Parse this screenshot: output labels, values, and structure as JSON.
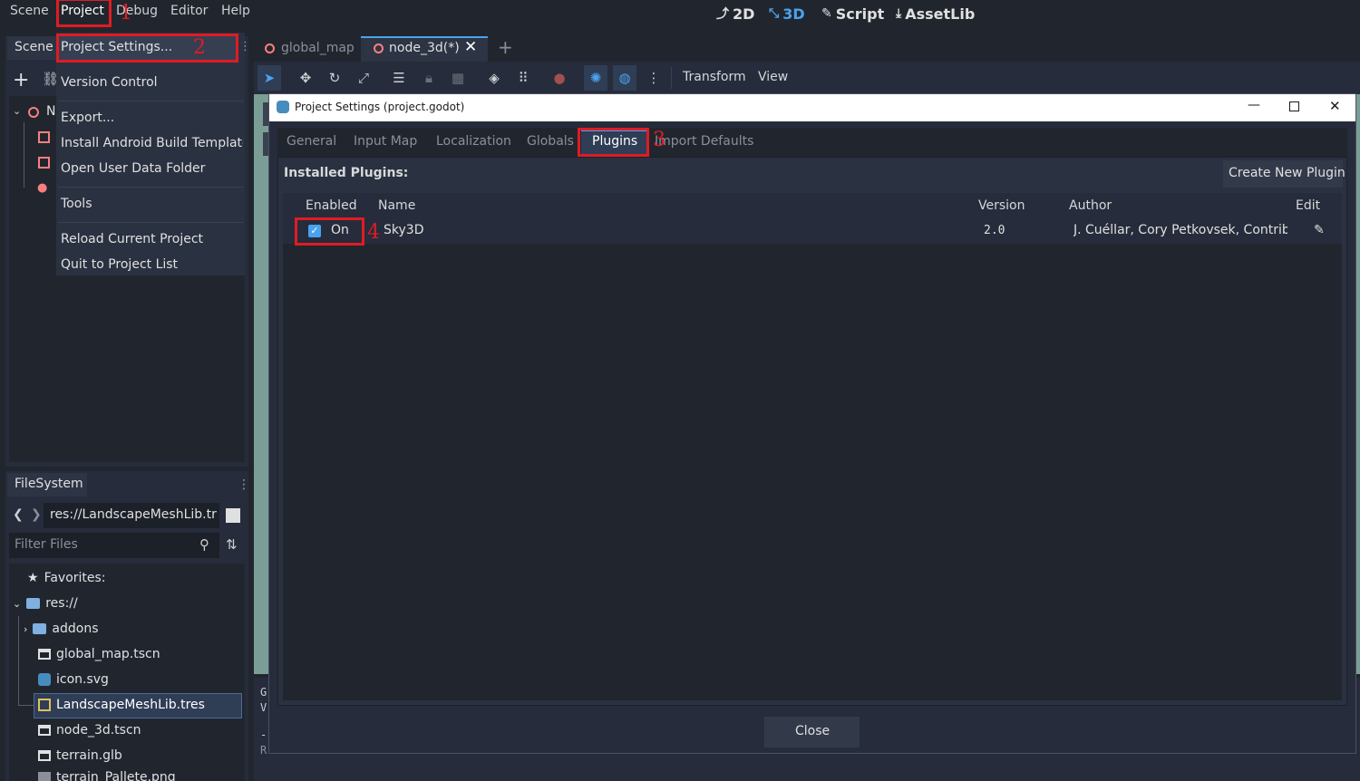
{
  "menubar": {
    "items": [
      "Scene",
      "Project",
      "Debug",
      "Editor",
      "Help"
    ],
    "workspaces": [
      {
        "label": "2D",
        "icon": "2d-icon"
      },
      {
        "label": "3D",
        "icon": "3d-icon"
      },
      {
        "label": "Script",
        "icon": "script-icon"
      },
      {
        "label": "AssetLib",
        "icon": "assetlib-icon"
      }
    ]
  },
  "scene_dock": {
    "tab_label": "Scene",
    "tree_first_label": "N"
  },
  "project_menu": {
    "items": [
      "Project Settings...",
      "Version Control",
      "Export...",
      "Install Android Build Template...",
      "Open User Data Folder",
      "Tools",
      "Reload Current Project",
      "Quit to Project List"
    ]
  },
  "filesystem": {
    "tab_label": "FileSystem",
    "path": "res://LandscapeMeshLib.tr",
    "filter_placeholder": "Filter Files",
    "favorites_label": "Favorites:",
    "root_label": "res://",
    "items": [
      {
        "label": "addons",
        "type": "folder"
      },
      {
        "label": "global_map.tscn",
        "type": "scene"
      },
      {
        "label": "icon.svg",
        "type": "svg"
      },
      {
        "label": "LandscapeMeshLib.tres",
        "type": "resource",
        "selected": true
      },
      {
        "label": "node_3d.tscn",
        "type": "scene"
      },
      {
        "label": "terrain.glb",
        "type": "scene"
      },
      {
        "label": "terrain_Pallete.png",
        "type": "image"
      }
    ]
  },
  "editor_tabs": [
    {
      "label": "global_map",
      "active": false
    },
    {
      "label": "node_3d(*)",
      "active": true
    }
  ],
  "viewport_toolbar": {
    "transform_label": "Transform",
    "view_label": "View"
  },
  "output_snippet": [
    "G",
    "V",
    "-",
    "R"
  ],
  "dialog": {
    "title": "Project Settings (project.godot)",
    "tabs": [
      "General",
      "Input Map",
      "Localization",
      "Globals",
      "Plugins",
      "Import Defaults"
    ],
    "active_tab": "Plugins",
    "installed_label": "Installed Plugins:",
    "create_button": "Create New Plugin",
    "columns": [
      "Enabled",
      "Name",
      "Version",
      "Author",
      "Edit"
    ],
    "plugins": [
      {
        "enabled": true,
        "enabled_label": "On",
        "name": "Sky3D",
        "version": "2.0",
        "author": "J. Cuéllar, Cory Petkovsek, Contrib..."
      }
    ],
    "close_button": "Close"
  },
  "annotations": [
    "1",
    "2",
    "3",
    "4"
  ],
  "colors": {
    "accent": "#4aa3ee",
    "annotation_red": "#e01b24",
    "panel_bg": "#262c3b",
    "window_bg": "#21262e"
  }
}
